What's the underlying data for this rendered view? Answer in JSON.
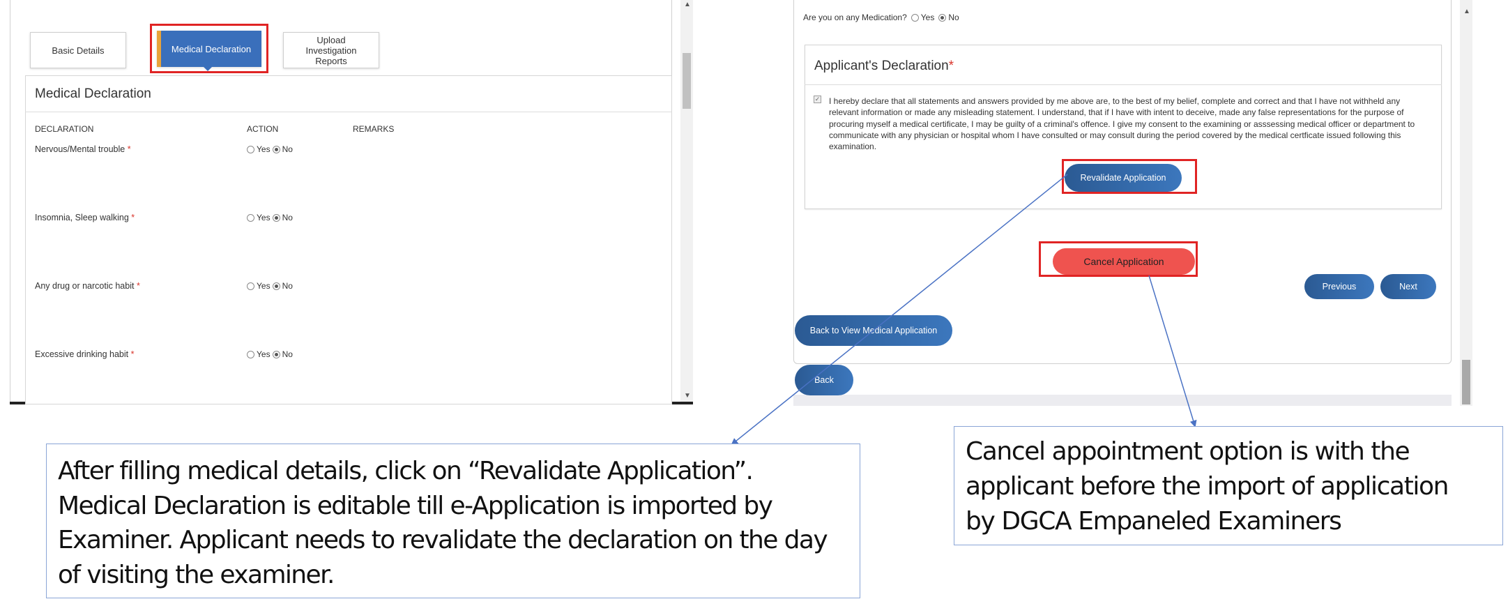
{
  "left_screen": {
    "tabs": {
      "basic_details": "Basic Details",
      "medical_declaration": "Medical Declaration",
      "upload_reports": "Upload Investigation Reports"
    },
    "panel_title": "Medical Declaration",
    "columns": {
      "declaration": "DECLARATION",
      "action": "ACTION",
      "remarks": "REMARKS"
    },
    "declarations": [
      {
        "label": "Nervous/Mental trouble",
        "required_mark": "*",
        "yes": "Yes",
        "no": "No",
        "selected": "No"
      },
      {
        "label": "Insomnia, Sleep walking",
        "required_mark": "*",
        "yes": "Yes",
        "no": "No",
        "selected": "No"
      },
      {
        "label": "Any drug or narcotic habit",
        "required_mark": "*",
        "yes": "Yes",
        "no": "No",
        "selected": "No"
      },
      {
        "label": "Excessive drinking habit",
        "required_mark": "*",
        "yes": "Yes",
        "no": "No",
        "selected": "No"
      }
    ]
  },
  "right_screen": {
    "medication_question": {
      "label": "Are you on any Medication?",
      "yes": "Yes",
      "no": "No",
      "selected": "No"
    },
    "declaration": {
      "title": "Applicant's Declaration",
      "required_mark": "*",
      "checked": true,
      "text": "I hereby declare that all statements and answers provided by me above are, to the best of my belief, complete and correct and that I have not withheld any relevant information or made any misleading statement. I understand, that if I have with intent to deceive, made any false representations for the purpose of procuring myself a medical certificate, I may be guilty of a criminal's offence. I give my consent to the examining or asssessing medical officer or department to communicate with any physician or hospital whom I have consulted or may consult during the period covered by the medical certficate issued following this examination."
    },
    "buttons": {
      "revalidate": "Revalidate Application",
      "cancel": "Cancel Application",
      "previous": "Previous",
      "next": "Next",
      "back_to_view": "Back to View Medical Application",
      "back": "Back"
    }
  },
  "callouts": {
    "left_lines": [
      "After filling medical details, click on “Revalidate Application”.",
      "Medical Declaration is editable till e-Application is imported by",
      "Examiner. Applicant needs to revalidate the declaration on the day",
      "of visiting the examiner."
    ],
    "right_lines": [
      "Cancel appointment option is with the",
      "applicant before the import of application",
      "by DGCA Empaneled Examiners"
    ]
  },
  "colors": {
    "highlight_red": "#e02424",
    "tab_active_blue": "#3a6fbb",
    "tab_accent_orange": "#e8a33a",
    "button_blue": "#2b5a93",
    "button_cancel_red": "#ef534f",
    "arrow_blue": "#4a72c4",
    "callout_border": "#8aa5d6"
  }
}
